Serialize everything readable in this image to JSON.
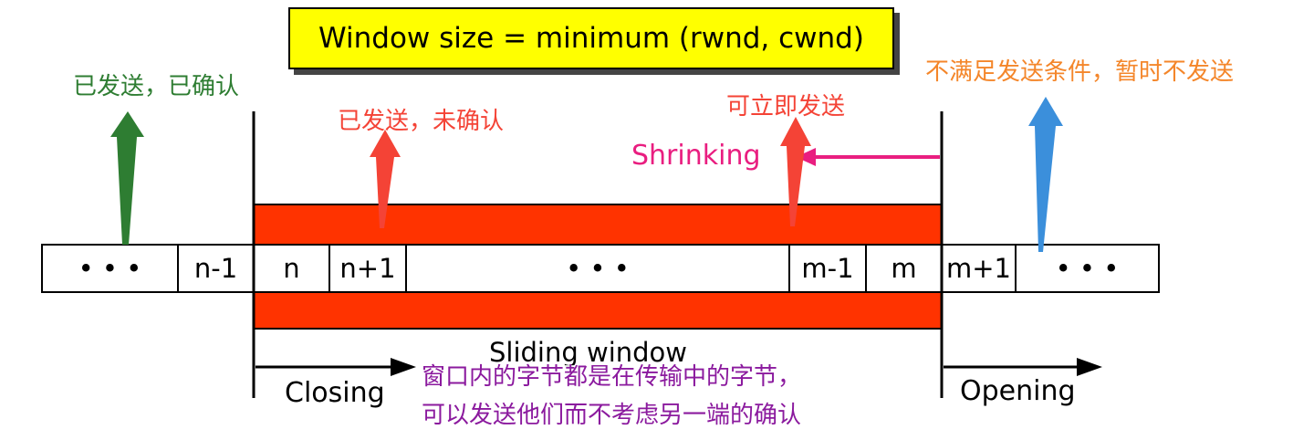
{
  "formula": "Window size = minimum (rwnd, cwnd)",
  "cells": [
    "• • •",
    "n-1",
    "n",
    "n+1",
    "• • •",
    "m-1",
    "m",
    "m+1",
    "• • •"
  ],
  "labels": {
    "sent_acked": "已发送，已确认",
    "sent_unacked": "已发送，未确认",
    "can_send": "可立即发送",
    "cannot_send": "不满足发送条件，暂时不发送",
    "shrinking": "Shrinking",
    "sliding_window": "Sliding window",
    "closing": "Closing",
    "opening": "Opening",
    "note_line1": "窗口内的字节都是在传输中的字节，",
    "note_line2": "可以发送他们而不考虑另一端的确认"
  },
  "colors": {
    "window_fill": "#ff3300",
    "formula_box": "#ffff00",
    "green": "#2e7d32",
    "red": "#f44336",
    "pink": "#e91e80",
    "orange": "#f4862a",
    "blue": "#3b8fdb",
    "purple": "#8b1a9e"
  }
}
